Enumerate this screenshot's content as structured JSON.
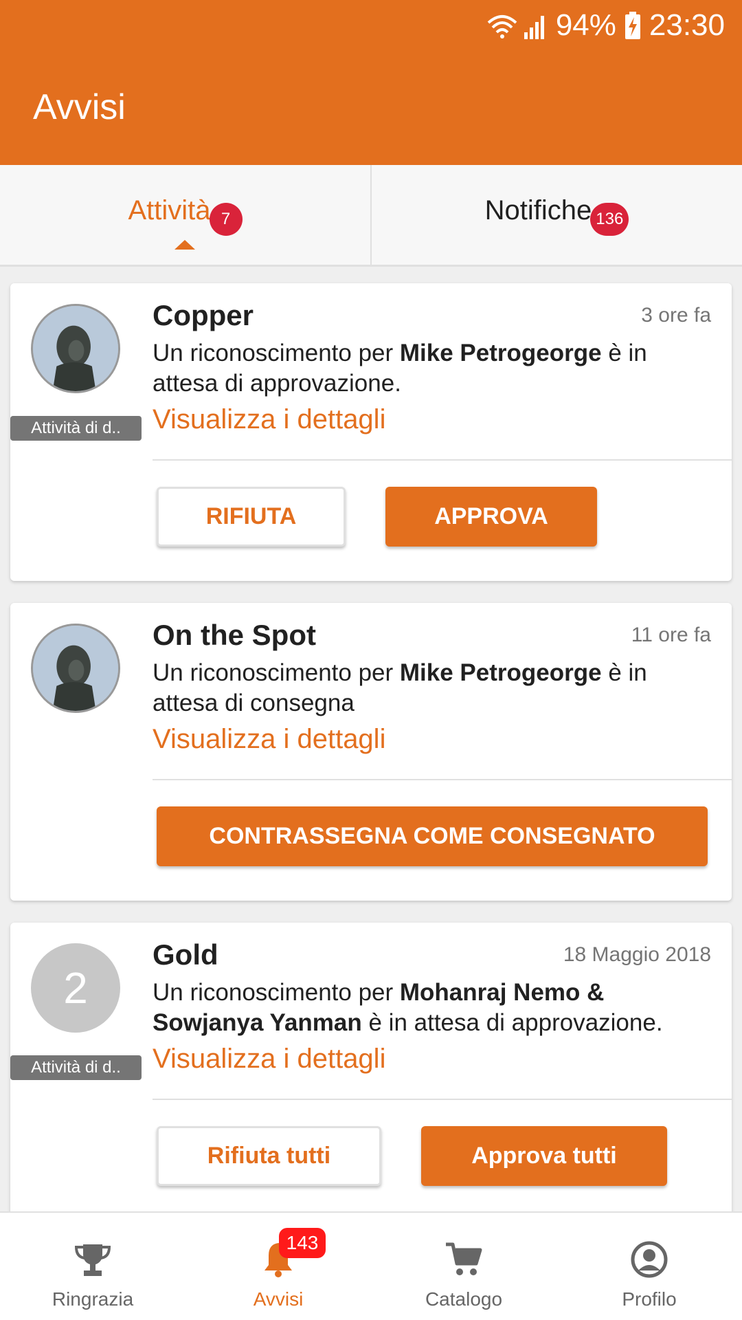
{
  "status_bar": {
    "battery": "94%",
    "time": "23:30"
  },
  "app_bar": {
    "title": "Avvisi"
  },
  "tabs": [
    {
      "label": "Attività",
      "badge": "7",
      "active": true
    },
    {
      "label": "Notifiche",
      "badge": "136",
      "active": false
    }
  ],
  "cards": [
    {
      "title": "Copper",
      "time": "3 ore fa",
      "text_prefix": "Un riconoscimento per ",
      "name": "Mike Petrogeorge",
      "text_suffix": " è in attesa di approvazione.",
      "link": "Visualizza i dettagli",
      "tag": "Attività di d..",
      "buttons": [
        "RIFIUTA",
        "APPROVA"
      ]
    },
    {
      "title": "On the Spot",
      "time": "11 ore fa",
      "text_prefix": "Un riconoscimento per ",
      "name": "Mike Petrogeorge",
      "text_suffix": " è in attesa di consegna",
      "link": "Visualizza i dettagli",
      "buttons": [
        "CONTRASSEGNA COME CONSEGNATO"
      ]
    },
    {
      "title": "Gold",
      "time": "18 Maggio 2018",
      "avatar_count": "2",
      "text_prefix": "Un riconoscimento per ",
      "name": "Mohanraj Nemo & Sowjanya Yanman",
      "text_suffix": " è in attesa di approvazione.",
      "link": "Visualizza i dettagli",
      "tag": "Attività di d..",
      "buttons": [
        "Rifiuta tutti",
        "Approva tutti"
      ]
    }
  ],
  "bottom_nav": [
    {
      "label": "Ringrazia",
      "icon": "trophy-icon"
    },
    {
      "label": "Avvisi",
      "icon": "bell-icon",
      "badge": "143",
      "active": true
    },
    {
      "label": "Catalogo",
      "icon": "cart-icon"
    },
    {
      "label": "Profilo",
      "icon": "profile-icon"
    }
  ],
  "colors": {
    "accent": "#e36f1e",
    "badge": "#d9233a",
    "nav_badge": "#ff1a1a"
  }
}
